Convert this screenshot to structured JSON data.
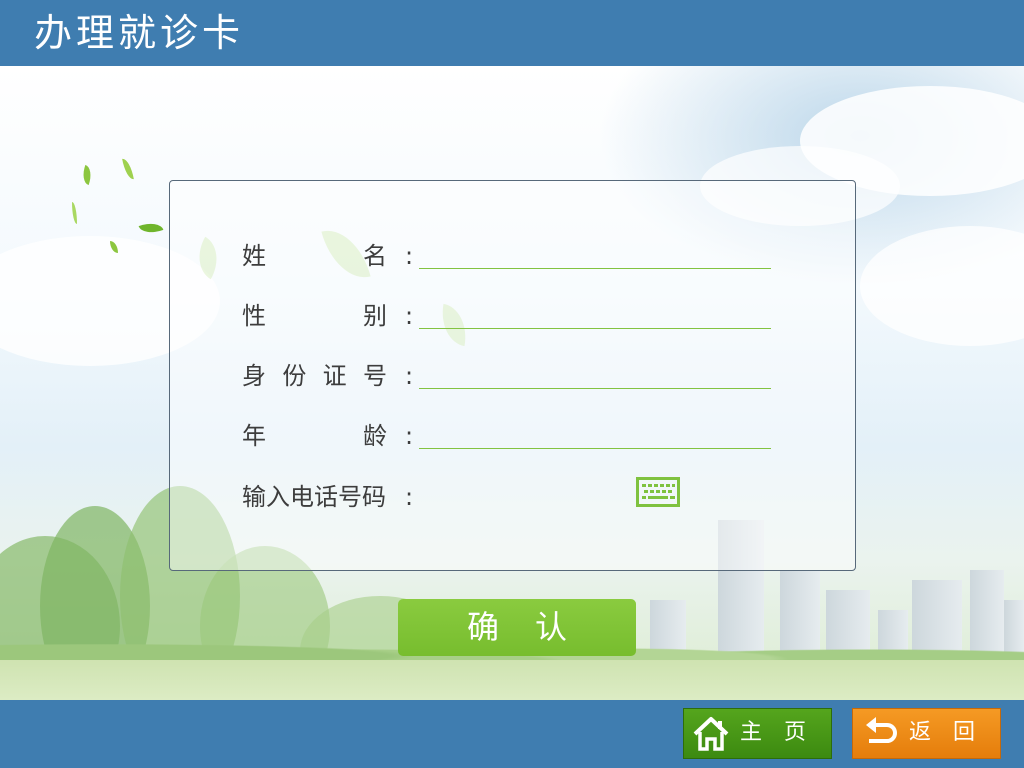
{
  "header": {
    "title": "办理就诊卡"
  },
  "form": {
    "rows": [
      {
        "chars": [
          "姓",
          "名"
        ],
        "colon": ":"
      },
      {
        "chars": [
          "性",
          "别"
        ],
        "colon": ":"
      },
      {
        "chars": [
          "身",
          "份",
          "证",
          "号"
        ],
        "colon": ":"
      },
      {
        "chars": [
          "年",
          "龄"
        ],
        "colon": ":"
      },
      {
        "label": "输入电话号码",
        "colon": ":"
      }
    ]
  },
  "confirm_label": "确认",
  "footer": {
    "home_label": "主页",
    "back_label": "返回"
  },
  "icons": {
    "keyboard": "keyboard-icon",
    "home": "home-icon",
    "back": "return-arrow-icon"
  },
  "colors": {
    "brand_blue": "#3f7db0",
    "accent_green": "#82c341",
    "home_green": "#4a9a17",
    "back_orange": "#f08c17"
  }
}
